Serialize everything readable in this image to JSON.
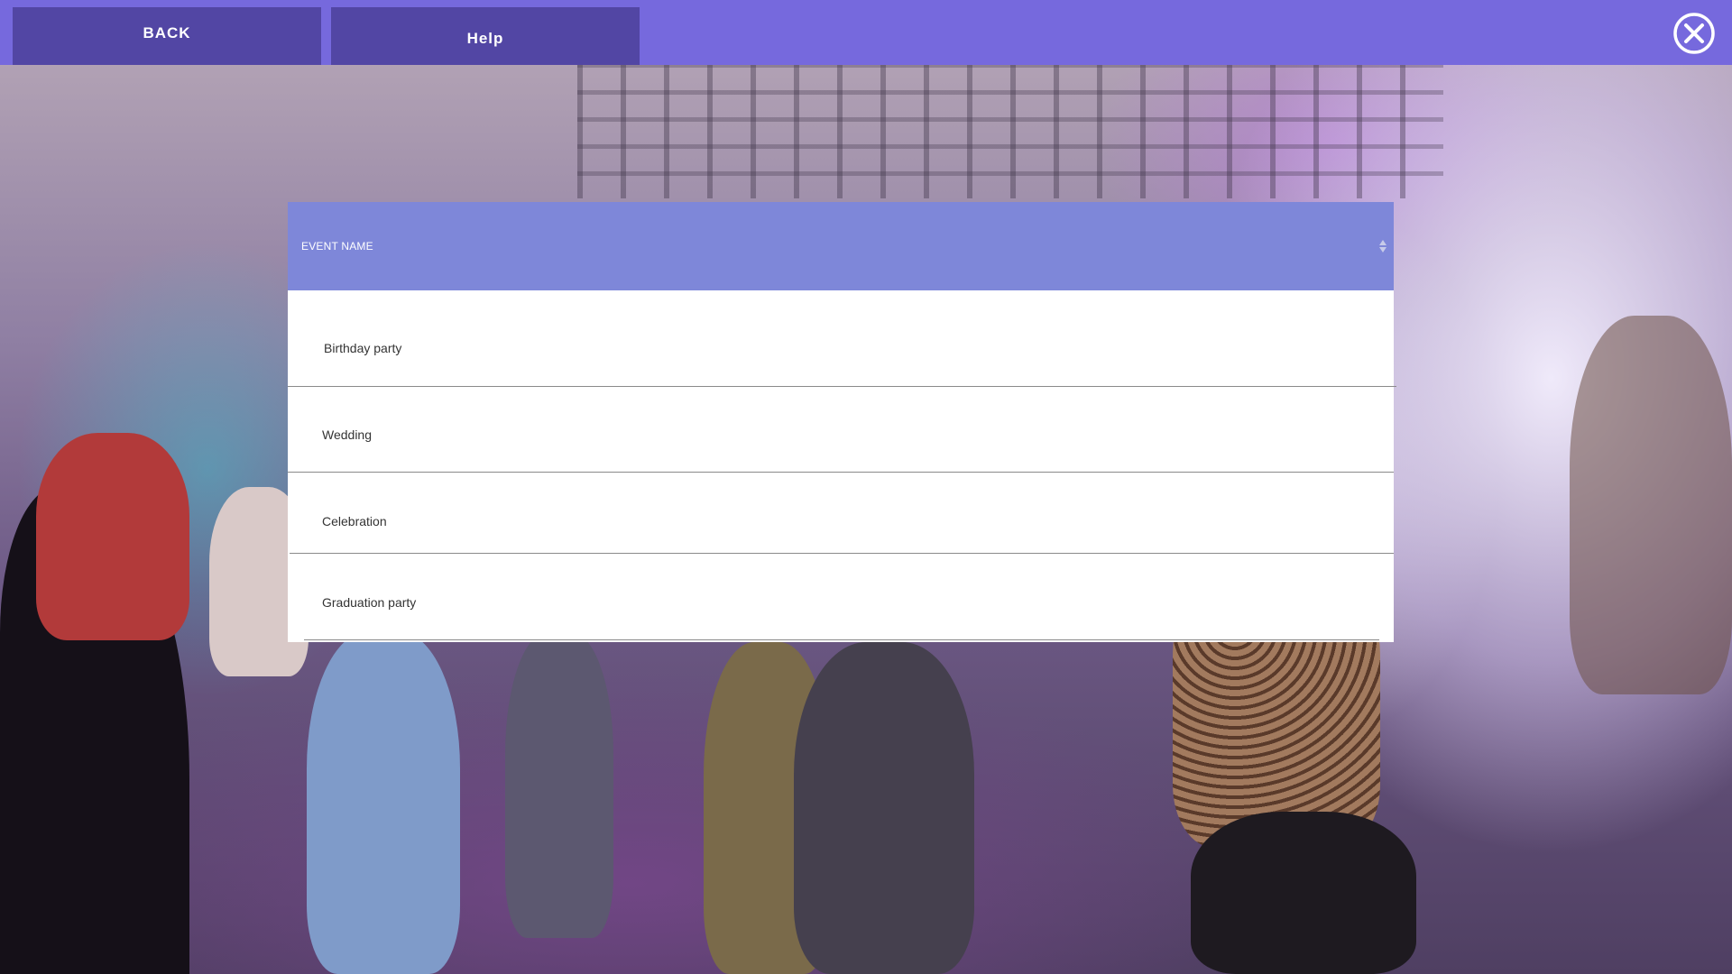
{
  "topbar": {
    "back_label": "BACK",
    "help_label": "Help",
    "close_icon": "close-circle-icon",
    "color": "#7669dd",
    "button_color": "#5246a4"
  },
  "table": {
    "column_header": "EVENT NAME",
    "sort_icon": "sort-arrows-icon",
    "header_color": "#7e87d9",
    "rows": [
      {
        "label": "Birthday party"
      },
      {
        "label": "Wedding"
      },
      {
        "label": "Celebration"
      },
      {
        "label": "Graduation party"
      }
    ]
  }
}
